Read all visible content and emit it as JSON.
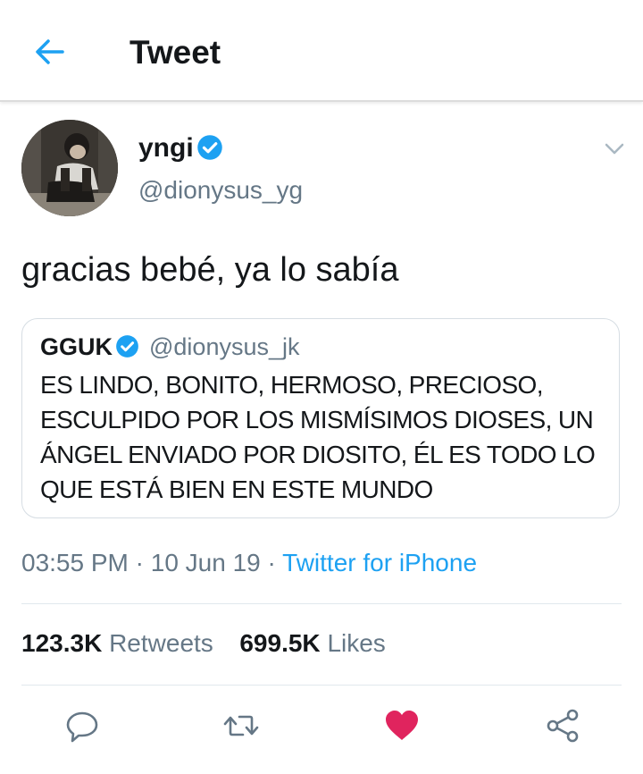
{
  "header": {
    "title": "Tweet"
  },
  "tweet": {
    "display_name": "yngi",
    "handle": "@dionysus_yg",
    "text": "gracias bebé, ya lo sabía",
    "timestamp": "03:55 PM",
    "date": "10 Jun 19",
    "source": "Twitter for iPhone",
    "separator": "·"
  },
  "quote": {
    "display_name": "GGUK",
    "handle": "@dionysus_jk",
    "text": "ES LINDO, BONITO, HERMOSO, PRECIOSO, ESCULPIDO POR LOS MISMÍSIMOS DIOSES, UN ÁNGEL ENVIADO POR DIOSITO, ÉL ES TODO LO QUE ESTÁ BIEN EN ESTE MUNDO"
  },
  "stats": {
    "retweets_count": "123.3K",
    "retweets_label": "Retweets",
    "likes_count": "699.5K",
    "likes_label": "Likes"
  },
  "icons": {
    "back": "back-arrow-icon",
    "verified": "verified-badge-icon",
    "caret": "chevron-down-icon",
    "reply": "reply-icon",
    "retweet": "retweet-icon",
    "like": "heart-icon",
    "share": "share-icon"
  },
  "colors": {
    "accent": "#1da1f2",
    "like_active": "#e0245e",
    "secondary_text": "#657786",
    "icon_gray": "#657786"
  }
}
